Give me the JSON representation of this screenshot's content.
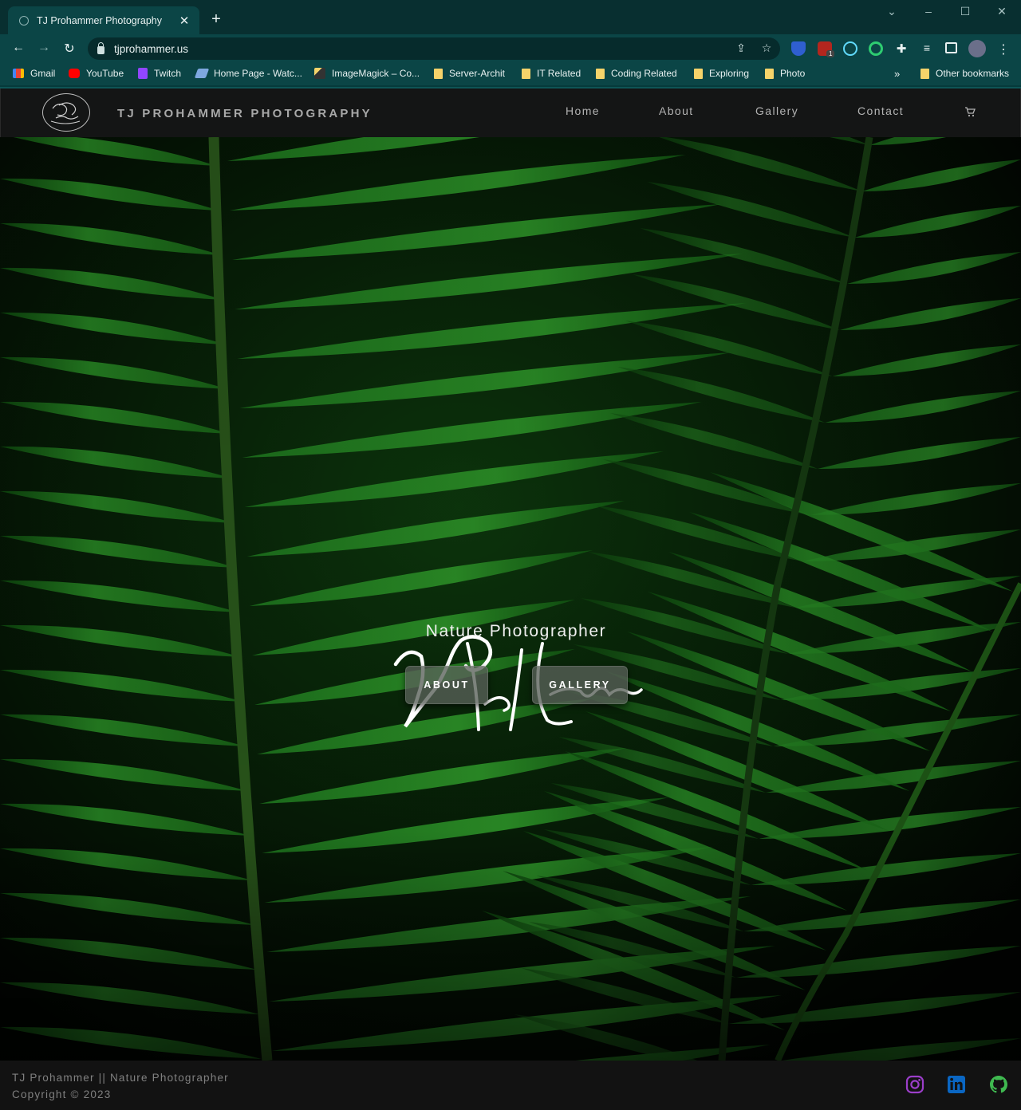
{
  "browser": {
    "tab_title": "TJ Prohammer Photography",
    "url": "tjprohammer.us",
    "bookmarks": [
      {
        "label": "Gmail",
        "icon": "gmail-icon"
      },
      {
        "label": "YouTube",
        "icon": "youtube-icon"
      },
      {
        "label": "Twitch",
        "icon": "twitch-icon"
      },
      {
        "label": "Home Page - Watc...",
        "icon": "watch-icon"
      },
      {
        "label": "ImageMagick – Co...",
        "icon": "wand-icon"
      },
      {
        "label": "Server-Archit",
        "icon": "folder-icon"
      },
      {
        "label": "IT Related",
        "icon": "folder-icon"
      },
      {
        "label": "Coding Related",
        "icon": "folder-icon"
      },
      {
        "label": "Exploring",
        "icon": "folder-icon"
      },
      {
        "label": "Photo",
        "icon": "folder-icon"
      }
    ],
    "overflow_label": "»",
    "other_bookmarks": "Other bookmarks",
    "ext_badge": "1",
    "colors": {
      "chrome": "#0b4546",
      "tabstrip": "#082f30"
    }
  },
  "site": {
    "title": "TJ PROHAMMER PHOTOGRAPHY",
    "nav": [
      "Home",
      "About",
      "Gallery",
      "Contact"
    ],
    "hero": {
      "tagline": "Nature Photographer",
      "buttons": [
        "ABOUT",
        "GALLERY"
      ]
    },
    "footer": {
      "line1": "TJ Prohammer || Nature Photographer",
      "line2": "Copyright © 2023"
    },
    "colors": {
      "header": "#141515",
      "instagram": "#9b3ec9",
      "linkedin": "#0a66c2",
      "github": "#3fb950"
    }
  }
}
